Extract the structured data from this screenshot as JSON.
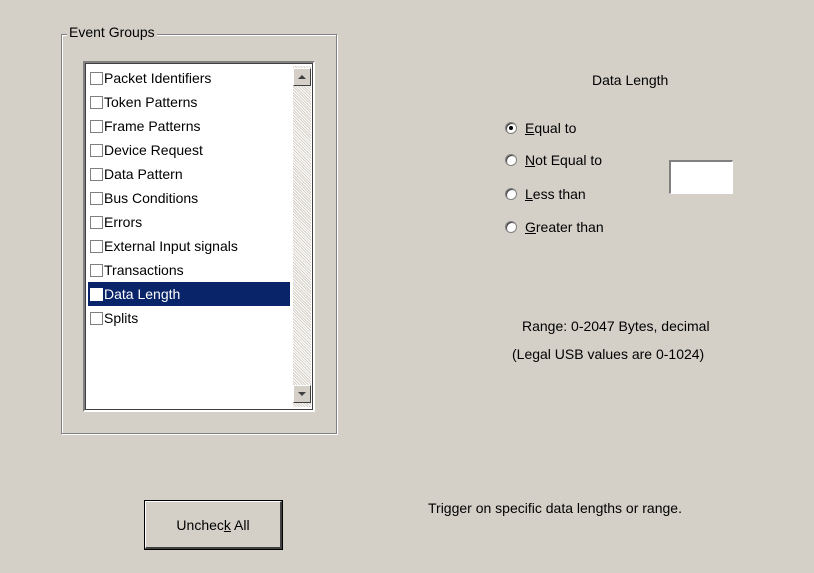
{
  "event_groups": {
    "title": "Event Groups",
    "items": [
      {
        "label": "Packet Identifiers",
        "checked": false,
        "selected": false
      },
      {
        "label": "Token Patterns",
        "checked": false,
        "selected": false
      },
      {
        "label": "Frame Patterns",
        "checked": false,
        "selected": false
      },
      {
        "label": "Device Request",
        "checked": false,
        "selected": false
      },
      {
        "label": "Data Pattern",
        "checked": false,
        "selected": false
      },
      {
        "label": "Bus Conditions",
        "checked": false,
        "selected": false
      },
      {
        "label": "Errors",
        "checked": false,
        "selected": false
      },
      {
        "label": "External Input signals",
        "checked": false,
        "selected": false
      },
      {
        "label": "Transactions",
        "checked": false,
        "selected": false
      },
      {
        "label": "Data Length",
        "checked": false,
        "selected": true
      },
      {
        "label": "Splits",
        "checked": false,
        "selected": false
      }
    ]
  },
  "data_length": {
    "title": "Data Length",
    "options": [
      {
        "accel": "E",
        "rest": "qual to",
        "checked": true
      },
      {
        "accel": "N",
        "rest": "ot Equal to",
        "checked": false
      },
      {
        "accel": "L",
        "rest": "ess than",
        "checked": false
      },
      {
        "accel": "G",
        "rest": "reater than",
        "checked": false
      }
    ],
    "value": "",
    "range_text": "Range:  0-2047 Bytes, decimal",
    "legal_text": "(Legal USB values are 0-1024)"
  },
  "uncheck_button": {
    "before": "Unchec",
    "accel": "k",
    "after": " All"
  },
  "description": "Trigger on specific data lengths or range.",
  "colors": {
    "selection": "#0a246a",
    "background": "#d4d0c8"
  }
}
